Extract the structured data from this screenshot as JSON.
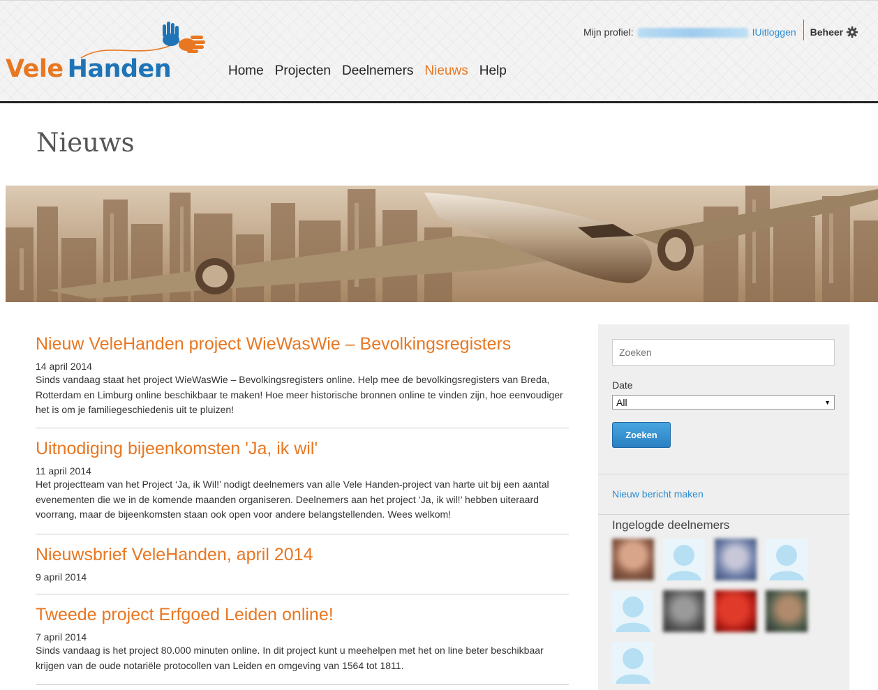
{
  "brand": {
    "name_part1": "Vele",
    "name_part2": "Handen"
  },
  "nav": {
    "items": [
      {
        "label": "Home",
        "active": false
      },
      {
        "label": "Projecten",
        "active": false
      },
      {
        "label": "Deelnemers",
        "active": false
      },
      {
        "label": "Nieuws",
        "active": true
      },
      {
        "label": "Help",
        "active": false
      }
    ]
  },
  "userbar": {
    "profile_label": "Mijn profiel:",
    "separator": "I",
    "logout_label": "Uitloggen",
    "admin_label": "Beheer",
    "admin_icon": "gear-icon"
  },
  "page": {
    "title": "Nieuws"
  },
  "articles": [
    {
      "title": "Nieuw VeleHanden project WieWasWie – Bevolkingsregisters",
      "date": "14 april 2014",
      "body": "Sinds vandaag staat het project WieWasWie – Bevolkingsregisters online. Help mee de bevolkingsregisters van Breda, Rotterdam en Limburg online beschikbaar te maken! Hoe meer historische bronnen online te vinden zijn, hoe eenvoudiger het is om je familiegeschiedenis uit te pluizen!"
    },
    {
      "title": "Uitnodiging bijeenkomsten 'Ja, ik wil'",
      "date": "11 april 2014",
      "body": "Het projectteam van het Project ‘Ja, ik Wil!’ nodigt deelnemers van alle Vele Handen-project van harte uit bij een aantal evenementen die we in de komende maanden organiseren. Deelnemers aan het project ‘Ja, ik wil!’ hebben uiteraard voorrang, maar de bijeenkomsten staan ook open voor andere belangstellenden. Wees welkom!"
    },
    {
      "title": "Nieuwsbrief VeleHanden, april 2014",
      "date": "9 april 2014",
      "body": ""
    },
    {
      "title": "Tweede project Erfgoed Leiden online!",
      "date": "7 april 2014",
      "body": "Sinds vandaag is het project 80.000 minuten online. In dit project kunt u meehelpen met het on line beter beschikbaar krijgen van de oude notariële protocollen van Leiden en omgeving van 1564 tot 1811."
    }
  ],
  "sidebar": {
    "search_placeholder": "Zoeken",
    "date_label": "Date",
    "date_selected": "All",
    "search_button": "Zoeken",
    "new_post_link": "Nieuw bericht maken",
    "logged_in_title": "Ingelogde deelnemers"
  },
  "colors": {
    "accent_orange": "#e87722",
    "brand_blue": "#1f74b7",
    "link_blue": "#2a8ccf"
  }
}
